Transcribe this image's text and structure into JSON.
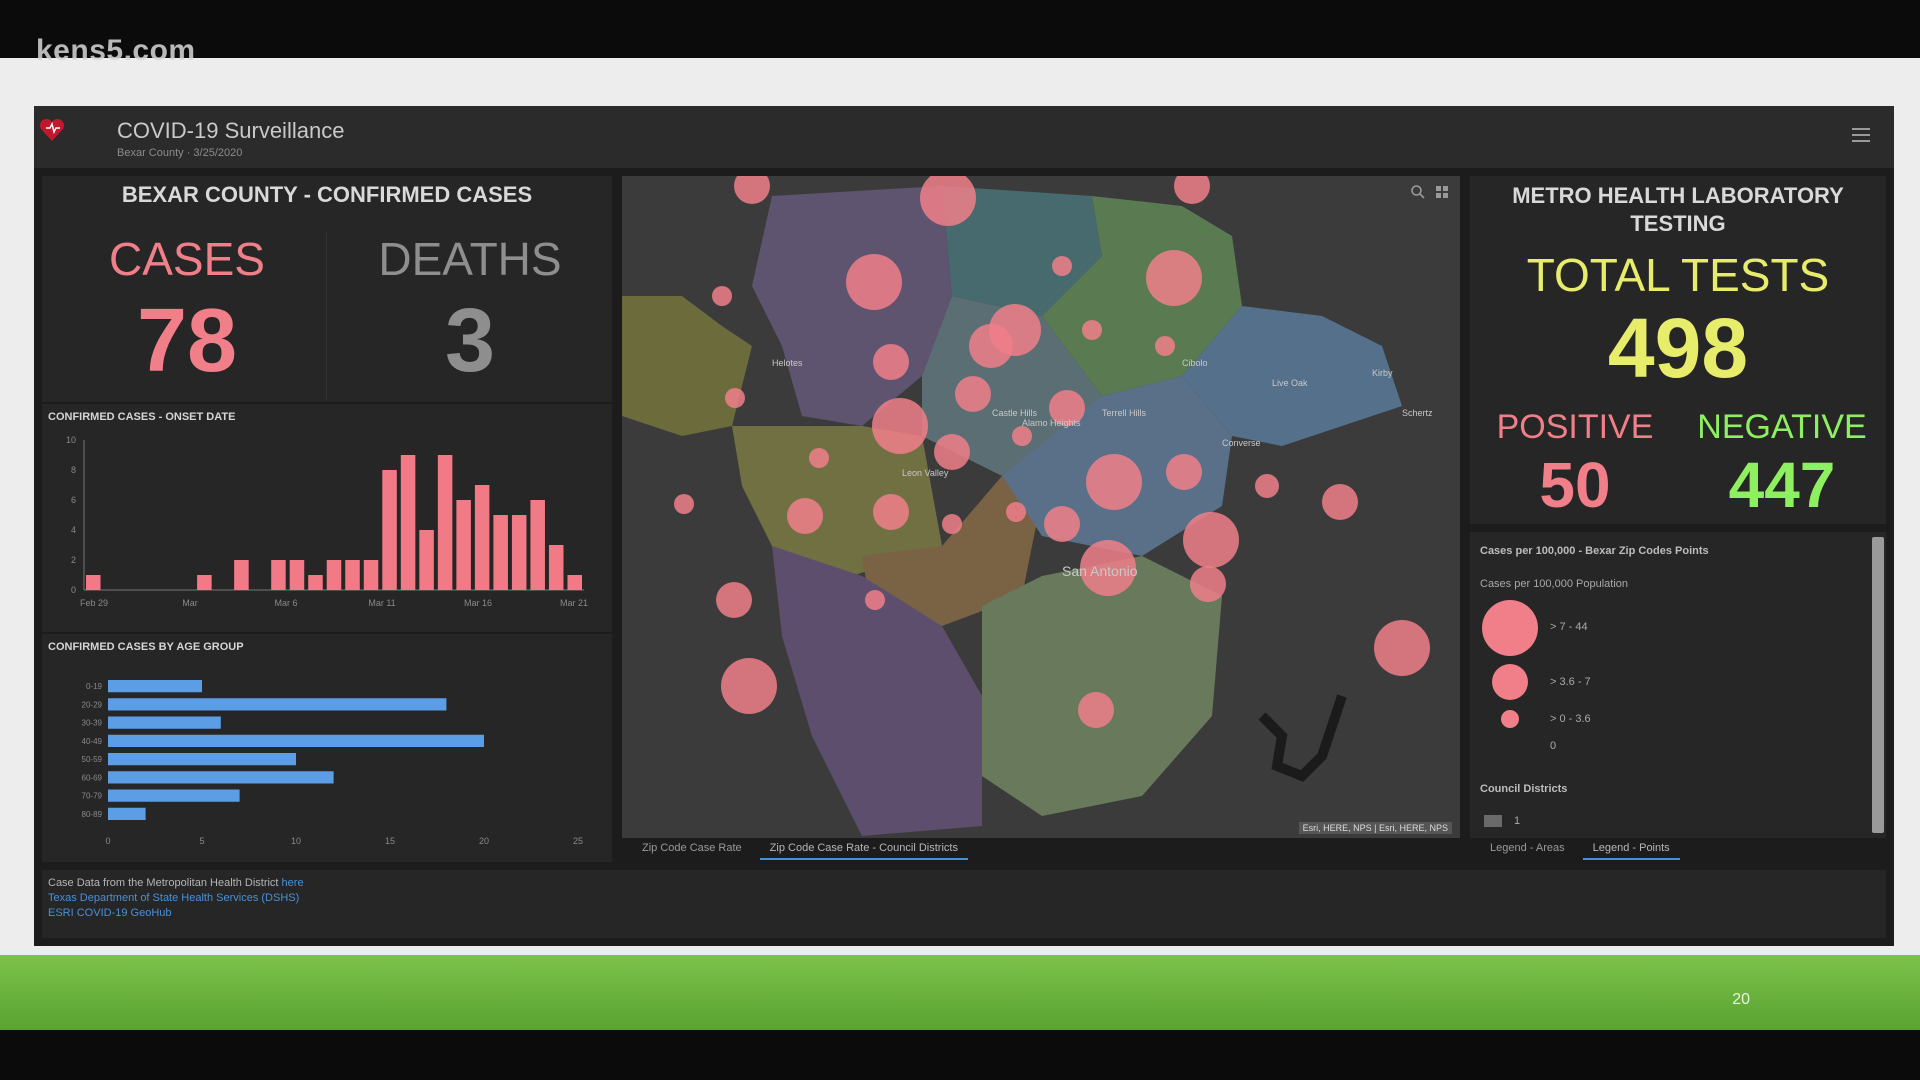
{
  "watermark": "kens5.com",
  "slide_number": "20",
  "header": {
    "title": "COVID-19 Surveillance",
    "subtitle": "Bexar County · 3/25/2020"
  },
  "left_panel": {
    "title": "BEXAR COUNTY - CONFIRMED CASES",
    "cases_label": "CASES",
    "cases_value": "78",
    "deaths_label": "DEATHS",
    "deaths_value": "3"
  },
  "onset_chart_title": "CONFIRMED CASES - ONSET DATE",
  "age_chart_title": "CONFIRMED CASES BY AGE GROUP",
  "chart_data": [
    {
      "type": "bar",
      "title": "CONFIRMED CASES - ONSET DATE",
      "x_tick_labels": [
        "Feb 29",
        "Mar",
        "Mar 6",
        "Mar 11",
        "Mar 16",
        "Mar 21"
      ],
      "y_ticks": [
        0,
        2,
        4,
        6,
        8,
        10
      ],
      "ylim": [
        0,
        10
      ],
      "values": [
        1,
        0,
        0,
        0,
        0,
        0,
        1,
        0,
        2,
        0,
        2,
        2,
        1,
        2,
        2,
        2,
        8,
        9,
        4,
        9,
        6,
        7,
        5,
        5,
        6,
        3,
        1
      ],
      "color": "#f27a86"
    },
    {
      "type": "bar",
      "orientation": "horizontal",
      "title": "CONFIRMED CASES BY AGE GROUP",
      "categories": [
        "0-19",
        "20-29",
        "30-39",
        "40-49",
        "50-59",
        "60-69",
        "70-79",
        "80-89"
      ],
      "values": [
        5,
        18,
        6,
        20,
        10,
        12,
        7,
        2
      ],
      "x_ticks": [
        0,
        5,
        10,
        15,
        20,
        25
      ],
      "xlim": [
        0,
        25
      ],
      "color": "#5b9ee6"
    }
  ],
  "map": {
    "labels": [
      "Helotes",
      "Leon Valley",
      "San Antonio",
      "Live Oak",
      "Converse",
      "Kirby",
      "Schertz",
      "Cibolo",
      "Alamo Heights",
      "Castle Hills",
      "Terrell Hills"
    ],
    "attribution": "Esri, HERE, NPS | Esri, HERE, NPS",
    "tabs": [
      "Zip Code Case Rate",
      "Zip Code Case Rate - Council Districts"
    ],
    "bubble_color": "#f07f89"
  },
  "right_panel": {
    "title": "METRO HEALTH LABORATORY TESTING",
    "total_label": "TOTAL TESTS",
    "total_value": "498",
    "positive_label": "POSITIVE",
    "positive_value": "50",
    "negative_label": "NEGATIVE",
    "negative_value": "447"
  },
  "legend": {
    "title": "Cases per 100,000 - Bexar Zip Codes Points",
    "subtitle": "Cases per 100,000 Population",
    "items": [
      "> 7 - 44",
      "> 3.6 - 7",
      "> 0 - 3.6",
      "0"
    ],
    "section2": "Council Districts",
    "section2_item": "1",
    "tabs": [
      "Legend - Areas",
      "Legend - Points"
    ]
  },
  "footer": {
    "line1": "Case Data from the Metropolitan Health District",
    "line1_link": "here",
    "line2": "Texas Department of State Health Services (DSHS)",
    "line3": "ESRI COVID-19 GeoHub"
  },
  "colors": {
    "cases": "#f07f89",
    "deaths": "#9a9a9a",
    "total": "#e7ec6a",
    "positive": "#f07f89",
    "negative": "#8ef061",
    "bar_red": "#f27a86",
    "bar_blue": "#5b9ee6",
    "link": "#4a90d9"
  },
  "icons": [
    "heart-logo-icon",
    "hamburger-menu-icon",
    "search-icon",
    "grid-icon"
  ]
}
